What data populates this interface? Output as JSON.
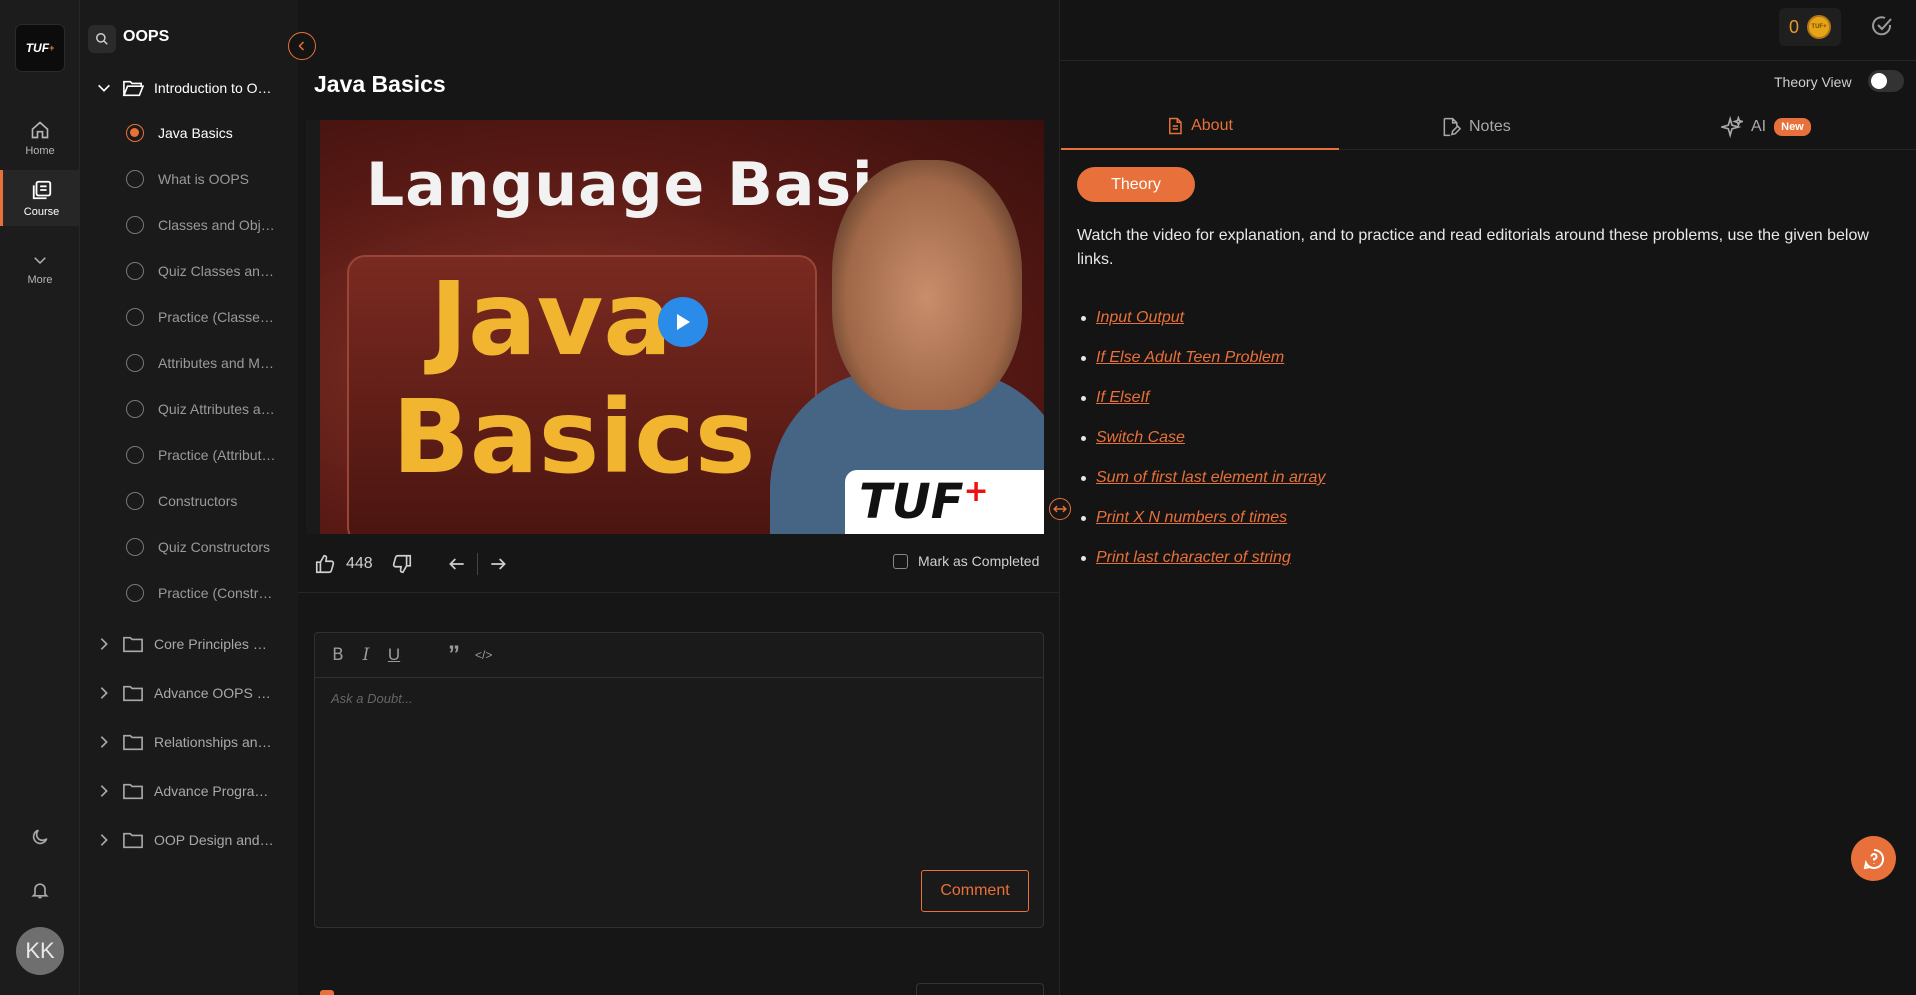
{
  "rail": {
    "logo": "TUF",
    "logo_plus": "+",
    "items": [
      {
        "label": "Home"
      },
      {
        "label": "Course"
      },
      {
        "label": "More"
      }
    ],
    "avatar": "KK"
  },
  "sidebar": {
    "search_value": "OOPS",
    "open_section": "Introduction to OOPS",
    "lessons": [
      "Java Basics",
      "What is OOPS",
      "Classes and Objects",
      "Quiz Classes and Objects",
      "Practice (Classes and Objects)",
      "Attributes and Methods",
      "Quiz Attributes and Methods",
      "Practice (Attributes and Methods)",
      "Constructors",
      "Quiz Constructors",
      "Practice (Constructors)"
    ],
    "sections": [
      "Core Principles of OOPS",
      "Advance OOPS features",
      "Relationships and Associations",
      "Advance Programming",
      "OOP Design and Principles"
    ]
  },
  "main": {
    "title": "Java Basics",
    "video": {
      "heading": "Language Basics",
      "big_line1": "Java",
      "big_line2": "Basics",
      "badge": "TUF",
      "badge_plus": "+"
    },
    "likes": "448",
    "mark_completed": "Mark as Completed",
    "editor": {
      "toolbar": [
        "B",
        "I",
        "U",
        "”",
        "</>"
      ],
      "placeholder": "Ask a Doubt...",
      "comment_label": "Comment"
    }
  },
  "panel": {
    "coins": "0",
    "coin_label": "TUF+",
    "theory_view": "Theory View",
    "tabs": {
      "about": "About",
      "notes": "Notes",
      "ai": "AI",
      "new": "New"
    },
    "pill": "Theory",
    "intro": "Watch the video for explanation, and to practice and read editorials around these problems, use the given below links.",
    "links": [
      "Input Output",
      "If Else Adult Teen Problem",
      "If ElseIf",
      "Switch Case",
      "Sum of first last element in array",
      "Print X N numbers of times",
      "Print last character of string"
    ]
  },
  "colors": {
    "accent": "#e8703a",
    "background": "#141414",
    "play": "#2b8be8"
  },
  "icons": [
    "search-icon",
    "home-icon",
    "course-icon",
    "chevron-down-icon",
    "moon-icon",
    "bell-icon",
    "folder-icon",
    "like-icon",
    "dislike-icon",
    "arrow-left-icon",
    "arrow-right-icon",
    "check-icon",
    "document-icon",
    "notes-icon",
    "sparkle-icon",
    "help-icon"
  ]
}
